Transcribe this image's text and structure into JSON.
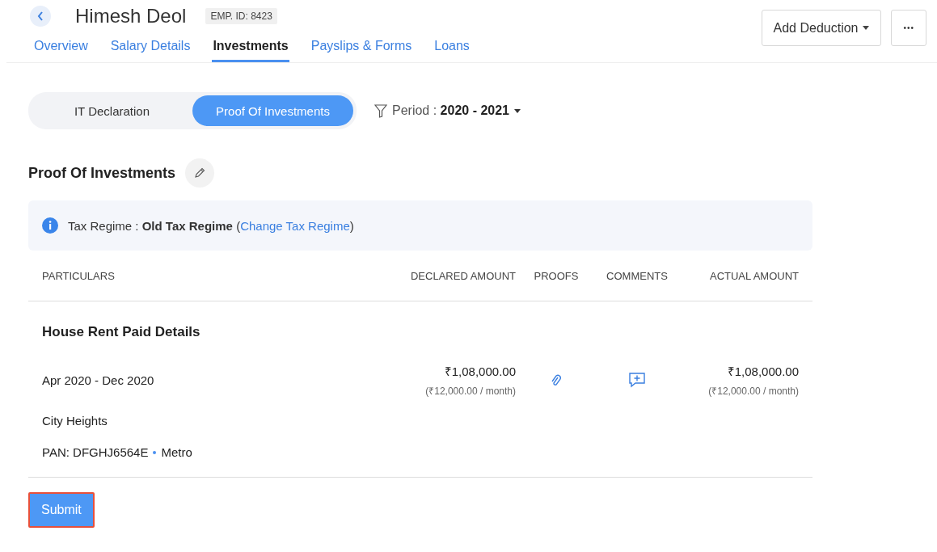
{
  "header": {
    "name": "Himesh Deol",
    "emp_id": "EMP. ID: 8423",
    "actions": [
      {
        "kind": "dropdown",
        "label": "Add Deduction"
      },
      {
        "kind": "more",
        "label": "•••"
      }
    ]
  },
  "tabs": [
    {
      "label": "Overview",
      "selected": false
    },
    {
      "label": "Salary Details",
      "selected": false
    },
    {
      "label": "Investments",
      "selected": true
    },
    {
      "label": "Payslips & Forms",
      "selected": false
    },
    {
      "label": "Loans",
      "selected": false
    }
  ],
  "segments": [
    {
      "label": "IT Declaration",
      "selected": false
    },
    {
      "label": "Proof Of Investments",
      "selected": true
    }
  ],
  "period": {
    "text": "Period : **2020 - 2021**"
  },
  "section": {
    "title": "Proof Of Investments"
  },
  "notice": {
    "text": "Tax Regime : **Old Tax Regime** (",
    "link": "Change Tax Regime",
    "after": ")"
  },
  "table": {
    "columns": [
      "PARTICULARS",
      "DECLARED AMOUNT",
      "PROOFS",
      "COMMENTS",
      "ACTUAL AMOUNT"
    ],
    "group": "House Rent Paid Details",
    "row": {
      "period": "Apr 2020 - Dec 2020",
      "declared": "₹1,08,000.00",
      "declared_monthly": "(₹12,000.00 / month)",
      "actual": "₹1,08,000.00",
      "actual_monthly": "(₹12,000.00 / month)"
    },
    "details": [
      "City Heights"
    ],
    "pan": "PAN: DFGHJ6564E",
    "city_type": "Metro"
  },
  "submit": {
    "label": "Submit",
    "highlighted": true
  }
}
